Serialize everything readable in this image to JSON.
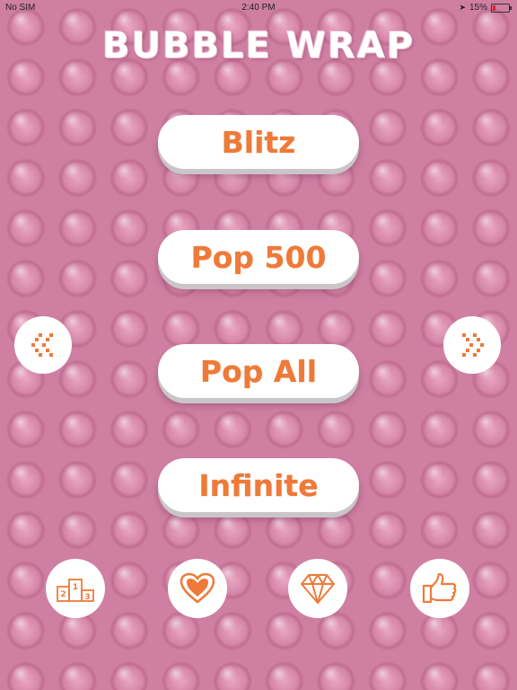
{
  "status_bar": {
    "carrier": "No SIM",
    "time": "2:40 PM",
    "battery": "15%"
  },
  "title": "BUBBLE WRAP",
  "modes": {
    "blitz": "Blitz",
    "pop500": "Pop 500",
    "popall": "Pop All",
    "infinite": "Infinite"
  },
  "icons": {
    "left_arrow": "chevron-left-icon",
    "right_arrow": "chevron-right-icon",
    "leaderboard": "podium-icon",
    "like": "heart-icon",
    "store": "diamond-icon",
    "rate": "thumbs-up-icon"
  },
  "podium_numbers": [
    "2",
    "1",
    "3"
  ],
  "colors": {
    "accent": "#ee7a3a",
    "background": "#cf7fa2",
    "button": "#ffffff"
  }
}
